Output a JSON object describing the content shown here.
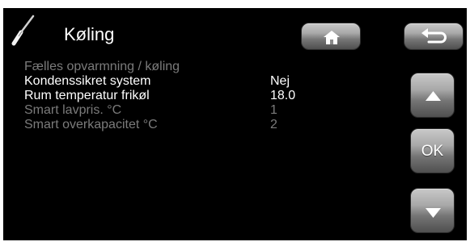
{
  "header": {
    "title": "Køling",
    "icon": "screwdriver-icon"
  },
  "nav": {
    "home_icon": "home-icon",
    "back_icon": "back-arrow-icon",
    "up_icon": "arrow-up-icon",
    "ok_label": "OK",
    "down_icon": "arrow-down-icon"
  },
  "settings": {
    "rows": [
      {
        "label": "Fælles opvarmning / køling",
        "value": "",
        "state": "disabled"
      },
      {
        "label": "Kondenssikret system",
        "value": "Nej",
        "state": "enabled"
      },
      {
        "label": "Rum temperatur frikøl",
        "value": "18.0",
        "state": "enabled"
      },
      {
        "label": "Smart lavpris. °C",
        "value": "1",
        "state": "disabled"
      },
      {
        "label": "Smart overkapacitet °C",
        "value": "2",
        "state": "disabled"
      }
    ]
  },
  "colors": {
    "background": "#000000",
    "text_enabled": "#ffffff",
    "text_disabled": "#7b7b7b",
    "button": "#8c8c8c"
  }
}
